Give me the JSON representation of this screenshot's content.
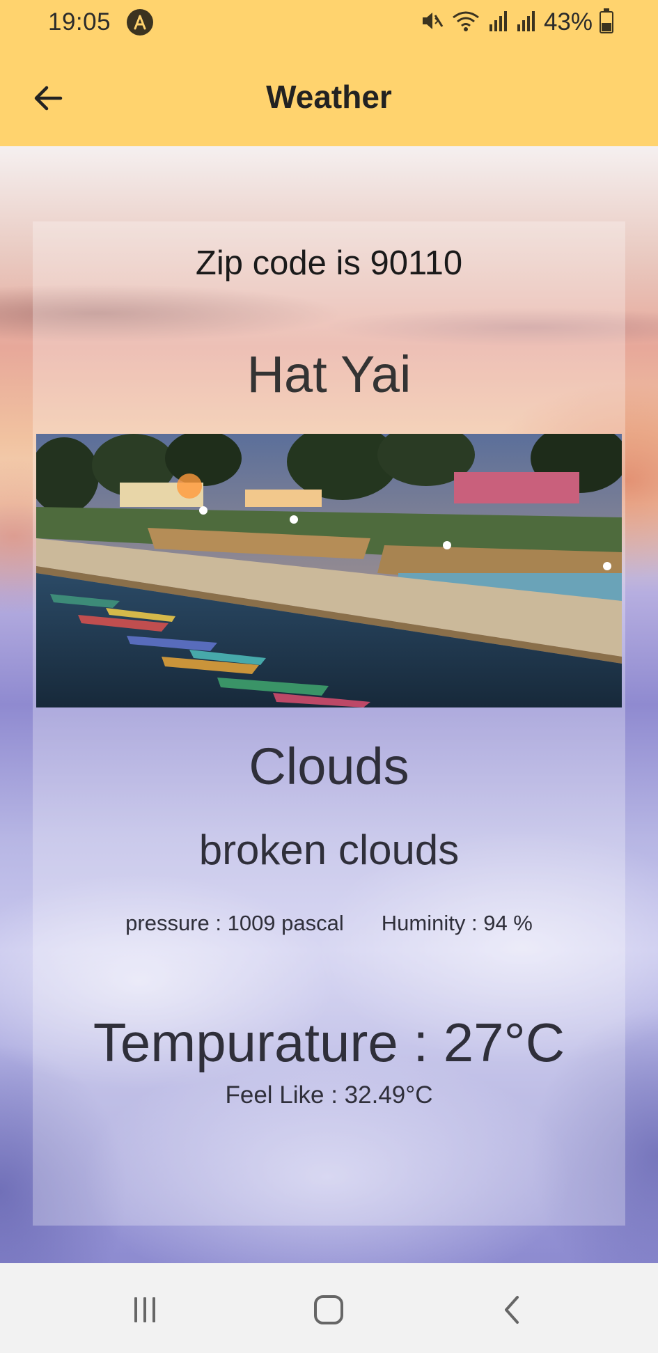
{
  "status_bar": {
    "time": "19:05",
    "app_icon": "a-icon",
    "icons": [
      "mute-icon",
      "wifi-icon",
      "signal-icon",
      "signal-icon",
      "battery-icon"
    ],
    "battery_percent": "43%"
  },
  "app_bar": {
    "title": "Weather",
    "back_icon": "arrow-left-icon",
    "color": "#ffd36e"
  },
  "weather": {
    "zip_label": "Zip code is 90110",
    "city": "Hat Yai",
    "main": "Clouds",
    "description": "broken clouds",
    "pressure": "pressure : 1009 pascal",
    "humidity": "Huminity : 94 %",
    "temperature": "Tempurature : 27°C",
    "feels_like": "Feel Like : 32.49°C"
  },
  "nav_bar": {
    "recents_icon": "recents-icon",
    "home_icon": "home-icon",
    "back_icon": "back-icon"
  }
}
